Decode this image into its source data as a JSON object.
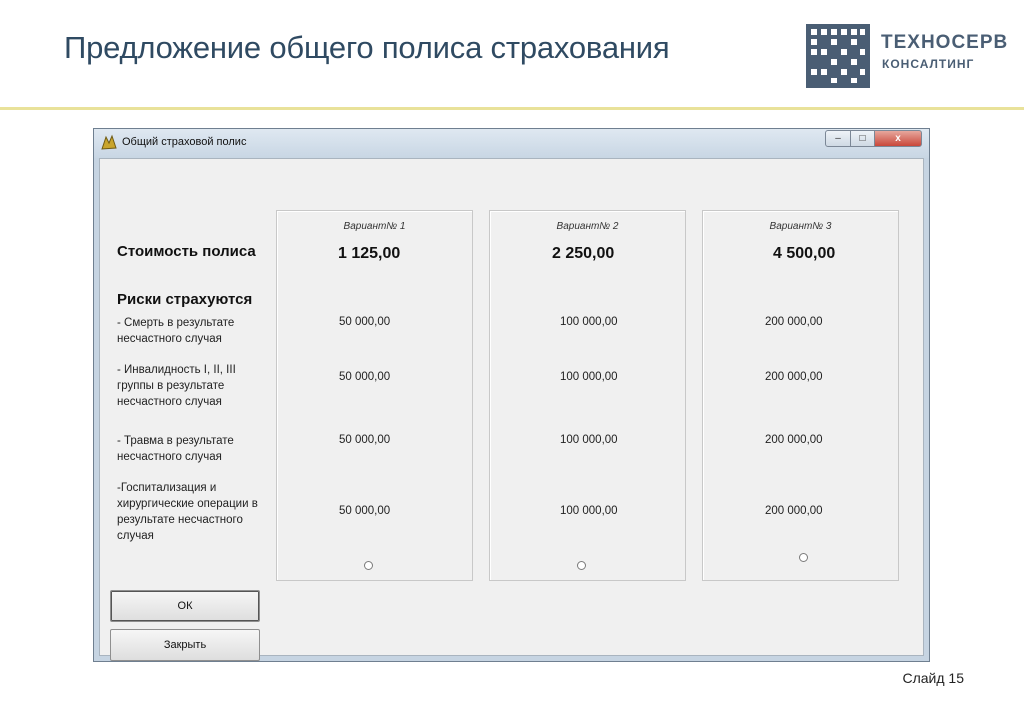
{
  "slide": {
    "title": "Предложение общего полиса страхования",
    "number": "Слайд 15"
  },
  "logo": {
    "line1": "ТЕХНОСЕРВ",
    "line2": "КОНСАЛТИНГ",
    "color": "#4a5e74"
  },
  "window": {
    "title": "Общий страховой полис",
    "controls": {
      "minimize": "–",
      "maximize": "□",
      "close": "x"
    }
  },
  "form": {
    "cost_label": "Стоимость полиса",
    "risks_label": "Риски страхуются",
    "risks": [
      "- Смерть в результате несчастного случая",
      "- Инвалидность I, II, III группы в результате несчастного случая",
      "- Травма в результате несчастного случая",
      "-Госпитализация и хирургические операции в результате несчастного случая"
    ],
    "variants": [
      {
        "name": "Вариант№ 1",
        "price": "1 125,00",
        "values": [
          "50 000,00",
          "50 000,00",
          "50 000,00",
          "50 000,00"
        ],
        "selected": false
      },
      {
        "name": "Вариант№ 2",
        "price": "2 250,00",
        "values": [
          "100 000,00",
          "100 000,00",
          "100 000,00",
          "100 000,00"
        ],
        "selected": false
      },
      {
        "name": "Вариант№ 3",
        "price": "4 500,00",
        "values": [
          "200 000,00",
          "200 000,00",
          "200 000,00",
          "200 000,00"
        ],
        "selected": false
      }
    ],
    "ok_label": "ОК",
    "close_label": "Закрыть"
  }
}
